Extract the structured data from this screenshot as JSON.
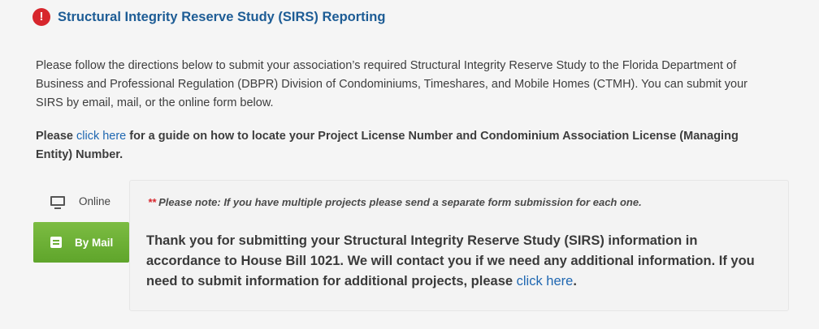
{
  "header": {
    "icon": "exclamation-circle-icon",
    "icon_glyph": "!",
    "title": "Structural Integrity Reserve Study (SIRS) Reporting",
    "accent_color": "#1d5c95",
    "alert_color": "#d7262d"
  },
  "intro": {
    "text": "Please follow the directions below to submit your association’s required Structural Integrity Reserve Study to the Florida Department of Business and Professional Regulation (DBPR) Division of Condominiums, Timeshares, and Mobile Homes (CTMH). You can submit your SIRS by email, mail, or the online form below."
  },
  "guide": {
    "prefix": "Please ",
    "link": "click here",
    "suffix": " for a guide on how to locate your Project License Number and Condominium Association License (Managing Entity) Number."
  },
  "tabs": {
    "items": [
      {
        "label": "Online",
        "icon": "monitor-icon",
        "active": false
      },
      {
        "label": "By Mail",
        "icon": "mail-icon",
        "active": true
      }
    ],
    "active_color": "#6cae35"
  },
  "panel": {
    "note_asterisks": "**",
    "note": "Please note: If you have multiple projects please send a separate form submission for each one.",
    "thankyou_text": "Thank you for submitting your Structural Integrity Reserve Study (SIRS) information in accordance to House Bill 1021. We will contact you if we need any additional information. If you need to submit information for additional projects, please ",
    "thankyou_link": "click here",
    "thankyou_end": "."
  }
}
